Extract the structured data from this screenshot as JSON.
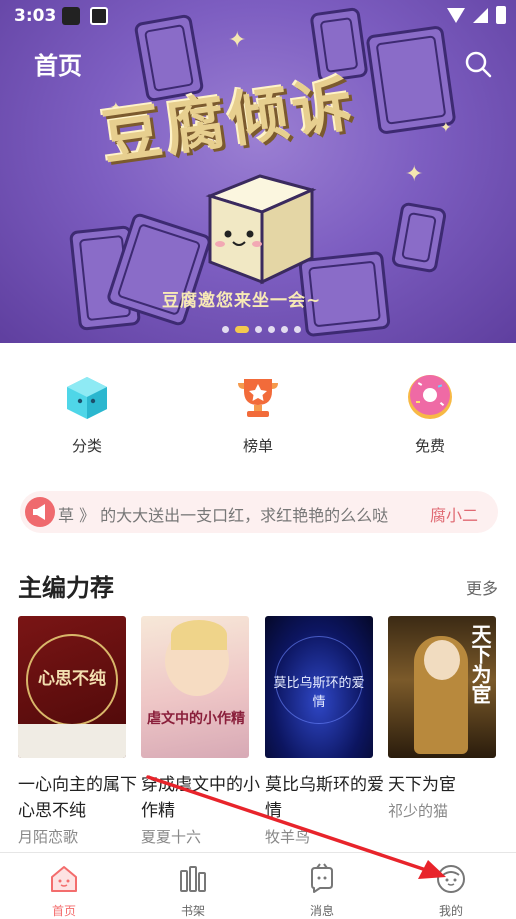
{
  "status_bar": {
    "time": "3:03"
  },
  "header": {
    "title": "首页"
  },
  "banner": {
    "logo": "豆腐倾诉",
    "tagline": "豆腐邀您来坐一会~",
    "dot_count": 6,
    "active_dot": 1
  },
  "categories": [
    {
      "label": "分类",
      "icon": "cube-icon"
    },
    {
      "label": "榜单",
      "icon": "trophy-icon"
    },
    {
      "label": "免费",
      "icon": "donut-icon"
    }
  ],
  "marquee": {
    "text": "草 》 的大大送出一支口红，求红艳艳的么么哒",
    "name": "腐小二"
  },
  "section": {
    "title": "主编力荐",
    "more": "更多"
  },
  "books": [
    {
      "title": "一心向主的属下心思不纯",
      "author": "月陌恋歌",
      "cover_text": "心思不纯"
    },
    {
      "title": "穿成虐文中的小作精",
      "author": "夏夏十六",
      "cover_text": "虐文中的小作精"
    },
    {
      "title": "莫比乌斯环的爱情",
      "author": "牧羊鸟",
      "cover_text": "莫比乌斯环的爱情"
    },
    {
      "title": "天下为宦",
      "author": "祁少的猫",
      "cover_text": "天下为宦"
    }
  ],
  "bottom_nav": [
    {
      "label": "首页",
      "icon": "home-icon",
      "active": true
    },
    {
      "label": "书架",
      "icon": "bookshelf-icon",
      "active": false
    },
    {
      "label": "消息",
      "icon": "message-icon",
      "active": false
    },
    {
      "label": "我的",
      "icon": "profile-icon",
      "active": false
    }
  ],
  "colors": {
    "accent": "#f36d6d",
    "banner": "#7d5ec1",
    "annotation_arrow": "#e8242b"
  }
}
